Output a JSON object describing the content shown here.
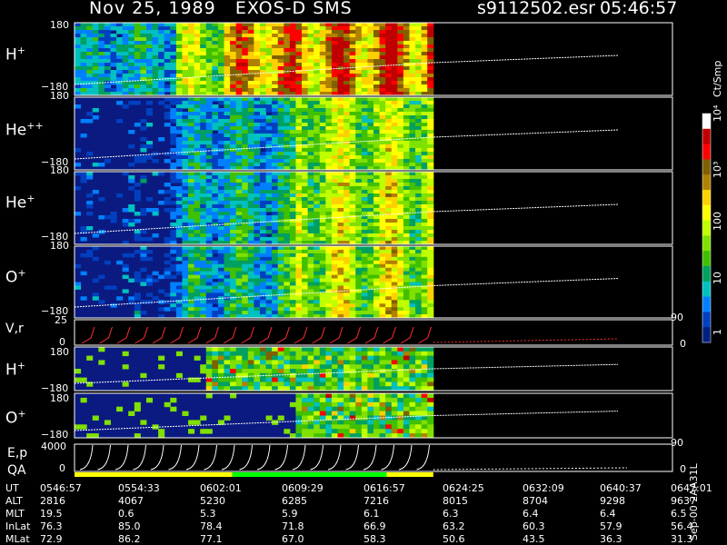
{
  "header": {
    "date": "Nov 25, 1989",
    "instrument": "EXOS-D SMS",
    "file": "s9112502.esr",
    "time": "05:46:57"
  },
  "colorbar": {
    "unit": "Ct/Smp",
    "ticks": [
      "10⁴",
      "10³",
      "100",
      "10",
      "1"
    ],
    "colors": [
      "#ffffff",
      "#c00000",
      "#ff0000",
      "#806000",
      "#b08000",
      "#ffd000",
      "#ffff00",
      "#c0ff00",
      "#80e000",
      "#40c000",
      "#00a060",
      "#00c0c0",
      "#0080ff",
      "#0040c0",
      "#002080"
    ]
  },
  "panels": [
    {
      "id": "h-plus",
      "name": "H",
      "charge": "+",
      "ymax": "180",
      "ymin": "−180"
    },
    {
      "id": "he-plusplus",
      "name": "He",
      "charge": "++",
      "ymax": "180",
      "ymin": "−180"
    },
    {
      "id": "he-plus",
      "name": "He",
      "charge": "+",
      "ymax": "180",
      "ymin": "−180"
    },
    {
      "id": "o-plus",
      "name": "O",
      "charge": "+",
      "ymax": "180",
      "ymin": "−180"
    }
  ],
  "vr_panel": {
    "label": "V,r",
    "ymax": "25",
    "ymin": "0",
    "rmax": "90",
    "rmin": "0"
  },
  "small_panels": [
    {
      "id": "h-plus-2",
      "name": "H",
      "charge": "+",
      "ymax": "180",
      "ymin": "−180"
    },
    {
      "id": "o-plus-2",
      "name": "O",
      "charge": "+",
      "ymax": "180",
      "ymin": "−180"
    }
  ],
  "ep_panel": {
    "label1": "E,p",
    "label2": "QA",
    "ymax": "4000",
    "ymin": "0",
    "rmax": "90",
    "rmin": "0"
  },
  "quality_bar": {
    "colors": [
      "#ffff00",
      "#00ff00",
      "#ffff00"
    ],
    "fractions": [
      0.44,
      0.43,
      0.13
    ]
  },
  "footer": {
    "rows": [
      {
        "label": "UT",
        "values": [
          "0546:57",
          "0554:33",
          "0602:01",
          "0609:29",
          "0616:57",
          "0624:25",
          "0632:09",
          "0640:37",
          "0647:01"
        ]
      },
      {
        "label": "ALT",
        "values": [
          "2816",
          "4067",
          "5230",
          "6285",
          "7216",
          "8015",
          "8704",
          "9298",
          "9637"
        ]
      },
      {
        "label": "MLT",
        "values": [
          "19.5",
          "0.6",
          "5.3",
          "5.9",
          "6.1",
          "6.3",
          "6.4",
          "6.4",
          "6.5"
        ]
      },
      {
        "label": "InLat",
        "values": [
          "76.3",
          "85.0",
          "78.4",
          "71.8",
          "66.9",
          "63.2",
          "60.3",
          "57.9",
          "56.4"
        ]
      },
      {
        "label": "MLat",
        "values": [
          "72.9",
          "86.2",
          "77.1",
          "67.0",
          "58.3",
          "50.6",
          "43.5",
          "36.3",
          "31.3"
        ]
      }
    ],
    "side_note": "Sep-00 2AA31L"
  },
  "chart_data": {
    "type": "heatmap",
    "title": "Nov 25, 1989   EXOS-D SMS",
    "x_axis": {
      "label": "UT",
      "ticks": [
        "0546:57",
        "0554:33",
        "0602:01",
        "0609:29",
        "0616:57",
        "0624:25",
        "0632:09",
        "0640:37",
        "0647:01"
      ]
    },
    "data_end_fraction": 0.6,
    "y_range_pitch": [
      -180,
      180
    ],
    "colorbar_range": [
      1,
      10000
    ],
    "colorbar_scale": "log",
    "series": [
      {
        "name": "H+"
      },
      {
        "name": "He++"
      },
      {
        "name": "He+"
      },
      {
        "name": "O+"
      }
    ]
  }
}
